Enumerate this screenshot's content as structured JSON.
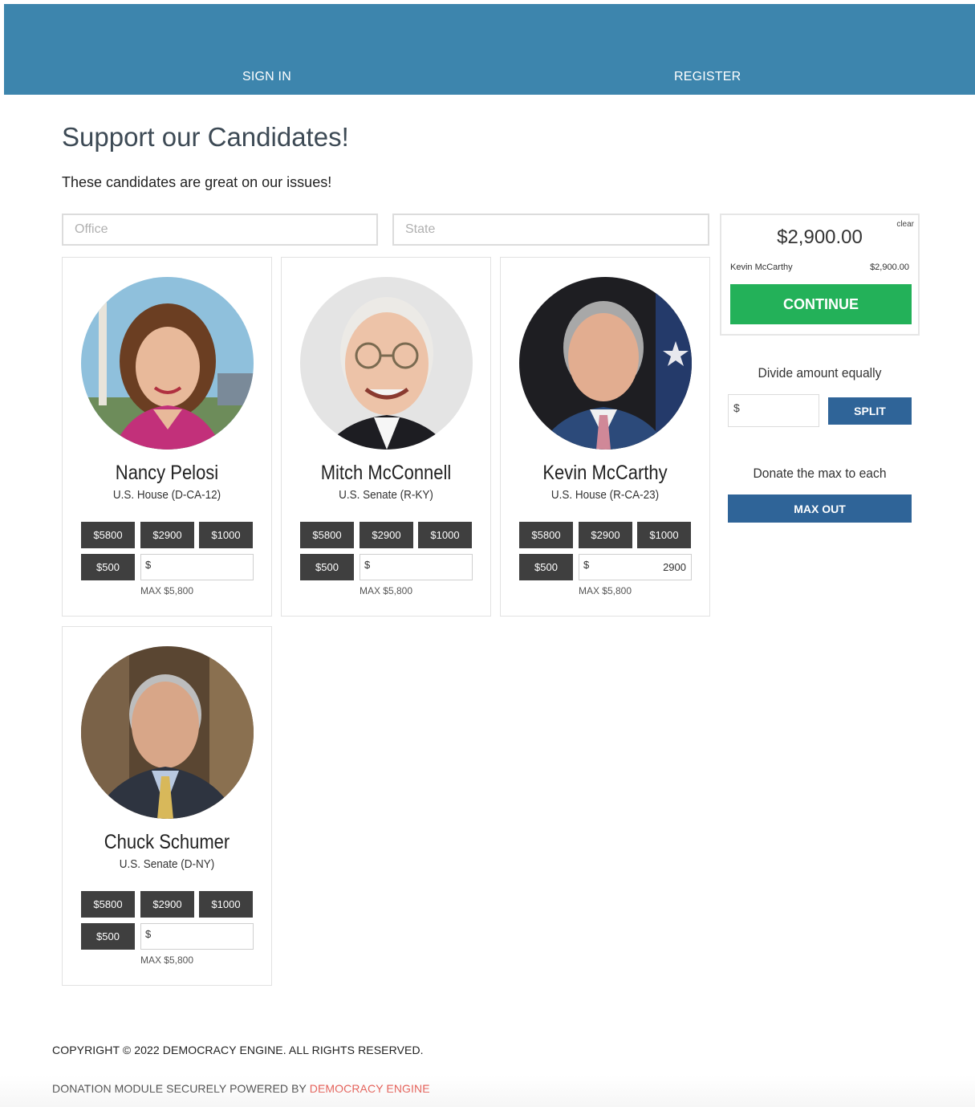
{
  "nav": {
    "sign_in": "SIGN IN",
    "register": "REGISTER"
  },
  "page": {
    "title": "Support our Candidates!",
    "subtitle": "These candidates are great on our issues!"
  },
  "filters": {
    "office_placeholder": "Office",
    "state_placeholder": "State"
  },
  "candidates": [
    {
      "name": "Nancy Pelosi",
      "office": "U.S. House (D-CA-12)",
      "amounts": [
        "$5800",
        "$2900",
        "$1000",
        "$500"
      ],
      "custom_value": "",
      "max_note": "MAX $5,800"
    },
    {
      "name": "Mitch McConnell",
      "office": "U.S. Senate (R-KY)",
      "amounts": [
        "$5800",
        "$2900",
        "$1000",
        "$500"
      ],
      "custom_value": "",
      "max_note": "MAX $5,800"
    },
    {
      "name": "Kevin McCarthy",
      "office": "U.S. House (R-CA-23)",
      "amounts": [
        "$5800",
        "$2900",
        "$1000",
        "$500"
      ],
      "custom_value": "2900",
      "max_note": "MAX $5,800"
    },
    {
      "name": "Chuck Schumer",
      "office": "U.S. Senate (D-NY)",
      "amounts": [
        "$5800",
        "$2900",
        "$1000",
        "$500"
      ],
      "custom_value": "",
      "max_note": "MAX $5,800"
    }
  ],
  "currency_symbol": "$",
  "summary": {
    "clear": "clear",
    "total": "$2,900.00",
    "line_name": "Kevin McCarthy",
    "line_amount": "$2,900.00",
    "continue": "CONTINUE"
  },
  "split": {
    "label": "Divide amount equally",
    "button": "SPLIT"
  },
  "max_out": {
    "label": "Donate the max to each",
    "button": "MAX OUT"
  },
  "footer": {
    "copyright": "COPYRIGHT © 2022 DEMOCRACY ENGINE. ALL RIGHTS RESERVED.",
    "powered_prefix": "DONATION MODULE SECURELY POWERED BY ",
    "powered_brand": "DEMOCRACY ENGINE"
  },
  "colors": {
    "header": "#3d85ad",
    "continue": "#23b159",
    "blue_button": "#2f6498",
    "amount_button": "#3f3f3f",
    "brand_link": "#e0352b"
  }
}
